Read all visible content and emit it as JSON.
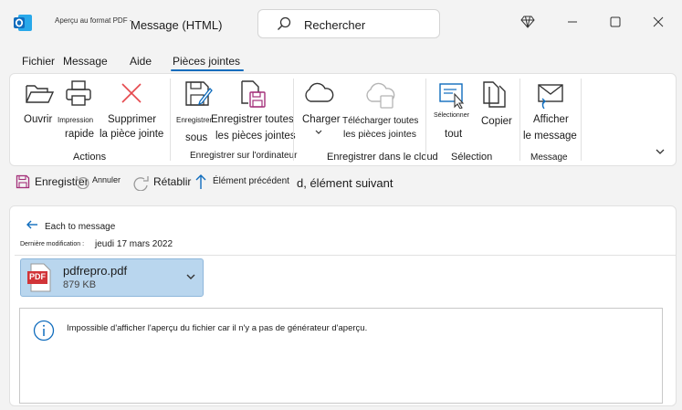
{
  "titlebar": {
    "small_title": "Aperçu au format PDF -",
    "title": "Message (HTML)",
    "search_placeholder": "Rechercher"
  },
  "tabs": [
    "Fichier",
    "Message",
    "Aide",
    "Pièces jointes"
  ],
  "ribbon": {
    "actions": {
      "open": "Ouvrir",
      "quick_print_1": "Impression",
      "quick_print_2": "rapide",
      "delete_1": "Supprimer",
      "delete_2": "la pièce jointe",
      "label": "Actions"
    },
    "save": {
      "save_as_small": "Enregistrer",
      "save_as_2": "sous",
      "save_all_1": "Enregistrer toutes",
      "save_all_2": "les pièces jointes",
      "label": "Enregistrer sur l'ordinateur"
    },
    "cloud": {
      "upload": "Charger",
      "upload_all_1": "Télécharger toutes",
      "upload_all_2": "les pièces jointes",
      "label": "Enregistrer dans le cloud"
    },
    "selection": {
      "select_all_small": "Sélectionner",
      "select_all_2": "tout",
      "copy": "Copier",
      "label": "Sélection"
    },
    "message": {
      "show_1": "Afficher",
      "show_2": "le message",
      "label": "Message"
    }
  },
  "qat": {
    "save": "Enregistrer",
    "undo": "Annuler",
    "redo": "Rétablir",
    "previous": "Élément précédent",
    "next": "d, élément suivant"
  },
  "content": {
    "back": "Each to message",
    "modified_label": "Dernière modification :",
    "modified_value": "jeudi 17 mars 2022",
    "attachment_name": "pdfrepro.pdf",
    "attachment_size": "879 KB",
    "pdf_badge": "PDF",
    "info_message": "Impossible d'afficher l'aperçu du fichier car il n'y a pas de générateur d'aperçu."
  },
  "colors": {
    "accent": "#0f6cbd",
    "attachment_bg": "#b9d6ee",
    "delete_red": "#e5484d",
    "save_purple": "#a4307a"
  }
}
